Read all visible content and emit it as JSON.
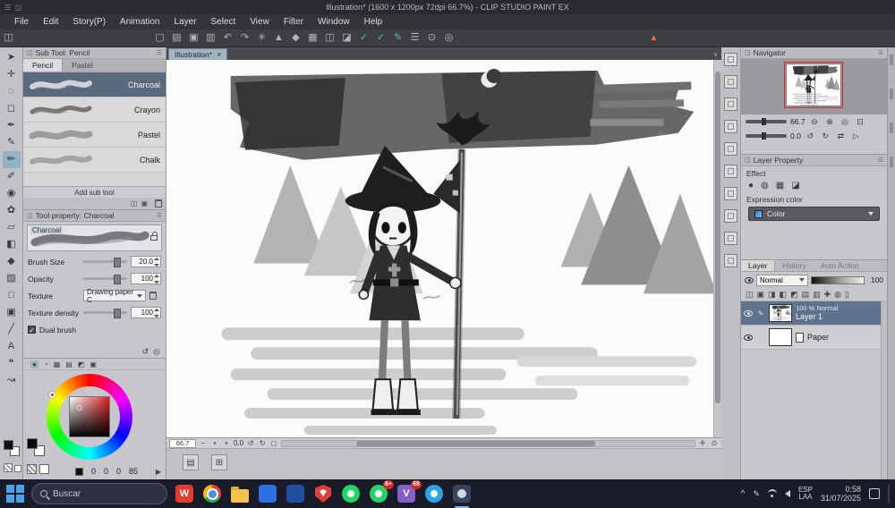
{
  "window": {
    "title": "Illustration* (1600 x 1200px 72dpi 66.7%) - CLIP STUDIO PAINT EX"
  },
  "icons": {
    "close": "×",
    "check": "✓",
    "wps": "W",
    "v": "V",
    "pen": "✎",
    "chev": "^",
    "menu": "☰",
    "win": "◫",
    "arrow": "▶",
    "stamp": "✑",
    "dropdown": "˅"
  },
  "menu": {
    "items": [
      "File",
      "Edit",
      "Story(P)",
      "Animation",
      "Layer",
      "Select",
      "View",
      "Filter",
      "Window",
      "Help"
    ]
  },
  "main_toolbar": {
    "glyphs": [
      "▢",
      "▤",
      "▣",
      "▥",
      "↶",
      "↷",
      "✳",
      "▲",
      "◆",
      "▦",
      "◫",
      "◪",
      "✓",
      "✓",
      "✎",
      "☰",
      "⊙",
      "◎"
    ]
  },
  "tools": {
    "glyphs": [
      "➤",
      "✛",
      "◌",
      "◻",
      "✒",
      "✎",
      "✏",
      "✐",
      "◉",
      "✿",
      "▱",
      "◧",
      "◆",
      "▨",
      "□",
      "▣",
      "╱",
      "A",
      "❝",
      "↝"
    ]
  },
  "subtool": {
    "header": "Sub Tool: Pencil",
    "tabs": [
      "Pencil",
      "Pastel"
    ],
    "brushes": [
      "Charcoal",
      "Crayon",
      "Pastel",
      "Chalk"
    ],
    "add_label": "Add sub tool"
  },
  "tool_property": {
    "header": "Tool property: Charcoal",
    "preview_label": "Charcoal",
    "rows": [
      {
        "label": "Brush Size",
        "value": "20.0"
      },
      {
        "label": "Opacity",
        "value": "100"
      },
      {
        "label": "Texture",
        "value": "Drawing paper C"
      },
      {
        "label": "Texture density",
        "value": "100"
      }
    ],
    "checkbox": "Dual brush"
  },
  "color_panel": {
    "icon_glyphs": [
      "●",
      "◔",
      "▦",
      "▤",
      "◩",
      "▣"
    ],
    "values": [
      "0",
      "0",
      "0",
      "85"
    ]
  },
  "canvas": {
    "tab": "Illustration*",
    "zoom": "66.7",
    "rotation": "0.0",
    "status_glyphs": {
      "minus": "−",
      "dot": "▪",
      "plus": "+",
      "rotl": "↺",
      "rotr": "↻",
      "fit": "◻",
      "hand": "✛",
      "find": "⊙"
    },
    "strip_glyphs": [
      "▤",
      "⊞"
    ]
  },
  "navigator": {
    "title": "Navigator",
    "zoom": "66.7",
    "rotation": "0.0",
    "glyphs1": [
      "⊖",
      "⊕",
      "◎",
      "⊡"
    ],
    "glyphs2": [
      "↺",
      "↻",
      "◁",
      "▷",
      "⇄"
    ]
  },
  "layer_property": {
    "title": "Layer Property",
    "effect": "Effect",
    "effect_glyphs": [
      "●",
      "◍",
      "▦",
      "◪"
    ],
    "expression": "Expression color",
    "expression_value": "Color"
  },
  "layers": {
    "tab": "Layer",
    "tab2": "History",
    "tab3": "Auto Action",
    "blend": "Normal",
    "opacity": "100",
    "toolbar_glyphs": [
      "◫",
      "▣",
      "◨",
      "◧",
      "◩",
      "▤",
      "▥",
      "✚",
      "◍",
      "▯"
    ],
    "items": [
      {
        "info": "100 % Normal",
        "name": "Layer 1"
      },
      {
        "name": "Paper"
      }
    ]
  },
  "taskbar": {
    "search": "Buscar",
    "badge1": "6+",
    "badge2": "68",
    "lang1": "ESP",
    "lang2": "LAA",
    "time": "0:58",
    "date": "31/07/2025"
  }
}
